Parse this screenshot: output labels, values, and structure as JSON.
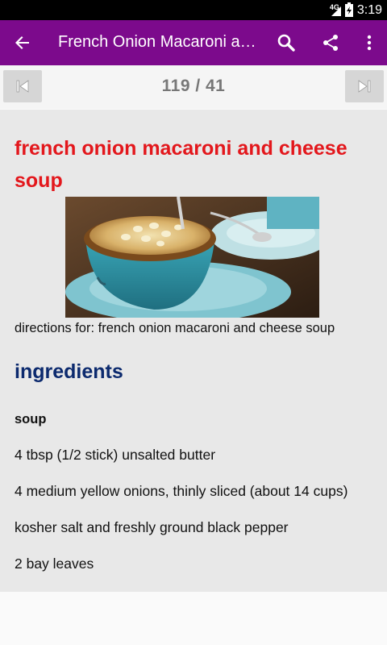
{
  "status_bar": {
    "network": "4G",
    "time": "3:19"
  },
  "app_bar": {
    "back_icon": "arrow-back-icon",
    "title": "French Onion Macaroni and Cheese Soup",
    "actions": [
      "search-icon",
      "share-icon",
      "more-vert-icon"
    ],
    "color": "#7c0a8c"
  },
  "pager": {
    "counter": "119 / 41",
    "prev_icon": "skip-previous-icon",
    "next_icon": "skip-next-icon"
  },
  "recipe": {
    "title": "french onion macaroni and cheese soup",
    "image_alt": "French onion macaroni and cheese soup in a blue bowl",
    "directions": "directions for: french onion macaroni and cheese soup",
    "ingredients_heading": "ingredients",
    "subsection": "soup",
    "ingredients": [
      "4 tbsp (1/2 stick) unsalted butter",
      "4 medium yellow onions, thinly sliced (about 14 cups)",
      "kosher salt and freshly ground black pepper",
      "2 bay leaves"
    ],
    "title_color": "#e3171c",
    "heading_color": "#0c2a6e"
  }
}
